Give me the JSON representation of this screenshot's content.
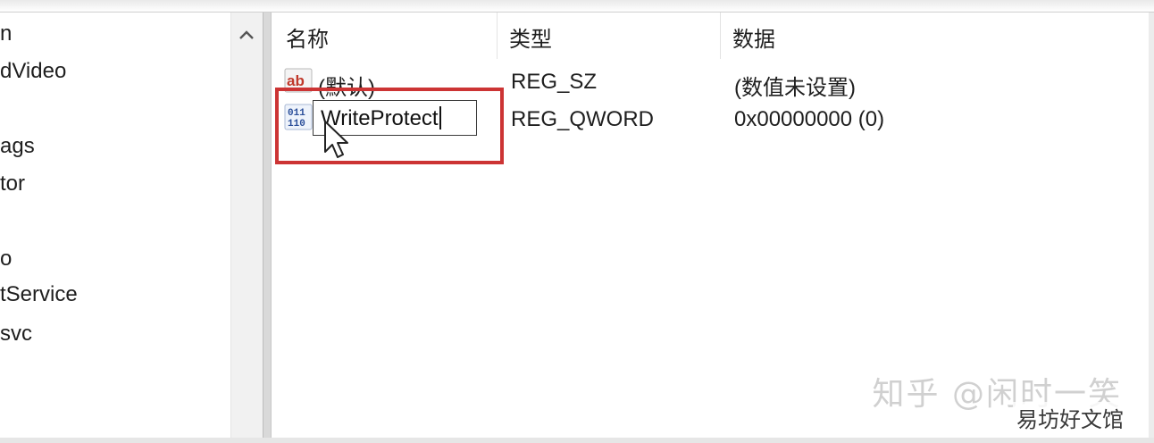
{
  "tree": {
    "items": [
      {
        "label": "n"
      },
      {
        "label": "dVideo"
      },
      {
        "label": "ags"
      },
      {
        "label": "tor"
      },
      {
        "label": "o"
      },
      {
        "label": "tService"
      },
      {
        "label": "svc"
      }
    ]
  },
  "scrollbar": {
    "up_icon": "chevron-up-icon"
  },
  "list": {
    "columns": [
      "名称",
      "类型",
      "数据"
    ],
    "rows": [
      {
        "icon": "string-value-icon",
        "name": "(默认)",
        "type": "REG_SZ",
        "data": "(数值未设置)"
      },
      {
        "icon": "binary-value-icon",
        "name": "WriteProtect",
        "type": "REG_QWORD",
        "data": "0x00000000 (0)"
      }
    ],
    "rename_value": "WriteProtect"
  },
  "overlay": {
    "highlight_color": "#cc3434",
    "watermark": "知乎 @闲时一笑",
    "watermark_site": "易坊好文馆"
  }
}
